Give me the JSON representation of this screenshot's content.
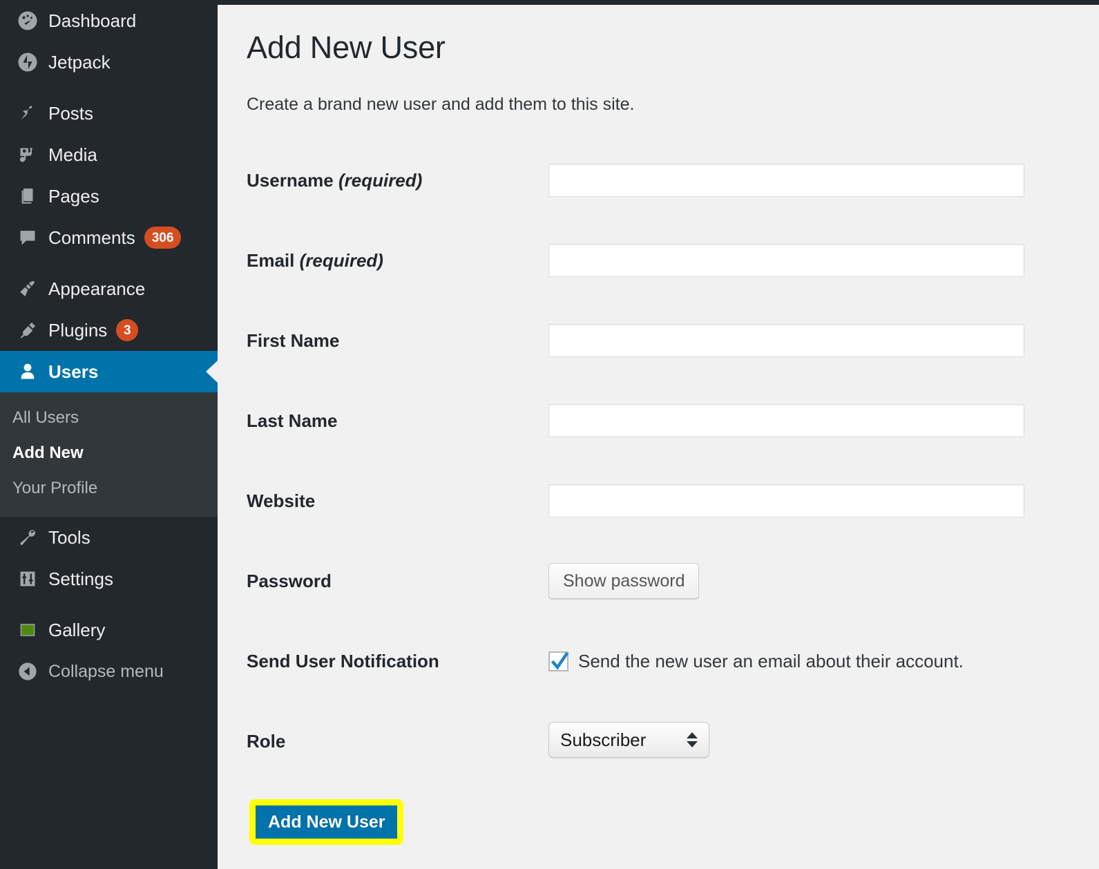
{
  "colors": {
    "sidebar_bg": "#23282d",
    "submenu_bg": "#32373c",
    "accent_blue": "#0073aa",
    "badge_orange": "#d54e21",
    "content_bg": "#f1f1f1",
    "highlight_yellow": "#ffff00",
    "gallery_green": "#4f8a10"
  },
  "sidebar": {
    "items": [
      {
        "label": "Dashboard",
        "icon": "dashboard-icon",
        "badge": null
      },
      {
        "label": "Jetpack",
        "icon": "jetpack-icon",
        "badge": null
      },
      {
        "label": "Posts",
        "icon": "pin-icon",
        "badge": null
      },
      {
        "label": "Media",
        "icon": "media-icon",
        "badge": null
      },
      {
        "label": "Pages",
        "icon": "pages-icon",
        "badge": null
      },
      {
        "label": "Comments",
        "icon": "comment-bubble-icon",
        "badge": "306"
      },
      {
        "label": "Appearance",
        "icon": "paintbrush-icon",
        "badge": null
      },
      {
        "label": "Plugins",
        "icon": "plug-icon",
        "badge": "3"
      },
      {
        "label": "Users",
        "icon": "user-icon",
        "badge": null,
        "active": true
      },
      {
        "label": "Tools",
        "icon": "wrench-icon",
        "badge": null
      },
      {
        "label": "Settings",
        "icon": "sliders-icon",
        "badge": null
      },
      {
        "label": "Gallery",
        "icon": "gallery-square-icon",
        "badge": null
      }
    ],
    "users_submenu": [
      {
        "label": "All Users",
        "current": false
      },
      {
        "label": "Add New",
        "current": true
      },
      {
        "label": "Your Profile",
        "current": false
      }
    ],
    "collapse": {
      "label": "Collapse menu",
      "icon": "collapse-arrow-icon"
    }
  },
  "main": {
    "title": "Add New User",
    "description": "Create a brand new user and add them to this site.",
    "fields": [
      {
        "label": "Username",
        "required_note": "(required)",
        "value": "",
        "name": "username"
      },
      {
        "label": "Email",
        "required_note": "(required)",
        "value": "",
        "name": "email"
      },
      {
        "label": "First Name",
        "required_note": "",
        "value": "",
        "name": "first-name"
      },
      {
        "label": "Last Name",
        "required_note": "",
        "value": "",
        "name": "last-name"
      },
      {
        "label": "Website",
        "required_note": "",
        "value": "",
        "name": "website"
      }
    ],
    "password": {
      "label": "Password",
      "show_button": "Show password"
    },
    "notification": {
      "label": "Send User Notification",
      "checkbox_label": "Send the new user an email about their account.",
      "checked": true
    },
    "role": {
      "label": "Role",
      "selected": "Subscriber"
    },
    "submit": {
      "label": "Add New User",
      "highlighted": true
    }
  }
}
